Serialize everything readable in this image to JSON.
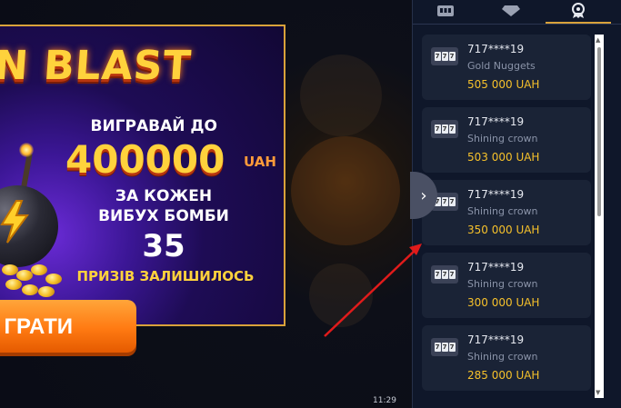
{
  "banner": {
    "title": "N BLAST",
    "win_up_to": "ВИГРАВАЙ ДО",
    "amount": "400000",
    "currency": "UAH",
    "each_line1": "ЗА КОЖЕН",
    "each_line2": "ВИБУХ БОМБИ",
    "count": "35",
    "prizes_left": "ПРИЗІВ ЗАЛИШИЛОСЬ",
    "play_button": "ГРАТИ"
  },
  "status": {
    "time": "11:29"
  },
  "panel": {
    "tabs": [
      {
        "icon": "slot-machine-icon"
      },
      {
        "icon": "diamond-icon"
      },
      {
        "icon": "award-icon",
        "active": true
      }
    ],
    "toggle_icon": "chevron-right-icon",
    "winners": [
      {
        "user": "717****19",
        "game": "Gold Nuggets",
        "amount": "505 000 UAH"
      },
      {
        "user": "717****19",
        "game": "Shining crown",
        "amount": "503 000 UAH"
      },
      {
        "user": "717****19",
        "game": "Shining crown",
        "amount": "350 000 UAH"
      },
      {
        "user": "717****19",
        "game": "Shining crown",
        "amount": "300 000 UAH"
      },
      {
        "user": "717****19",
        "game": "Shining crown",
        "amount": "285 000 UAH"
      }
    ]
  },
  "colors": {
    "accent": "#f6c12b",
    "panel_bg": "#0f172a",
    "card_bg": "#1a2336",
    "arrow": "#e01b1b"
  }
}
